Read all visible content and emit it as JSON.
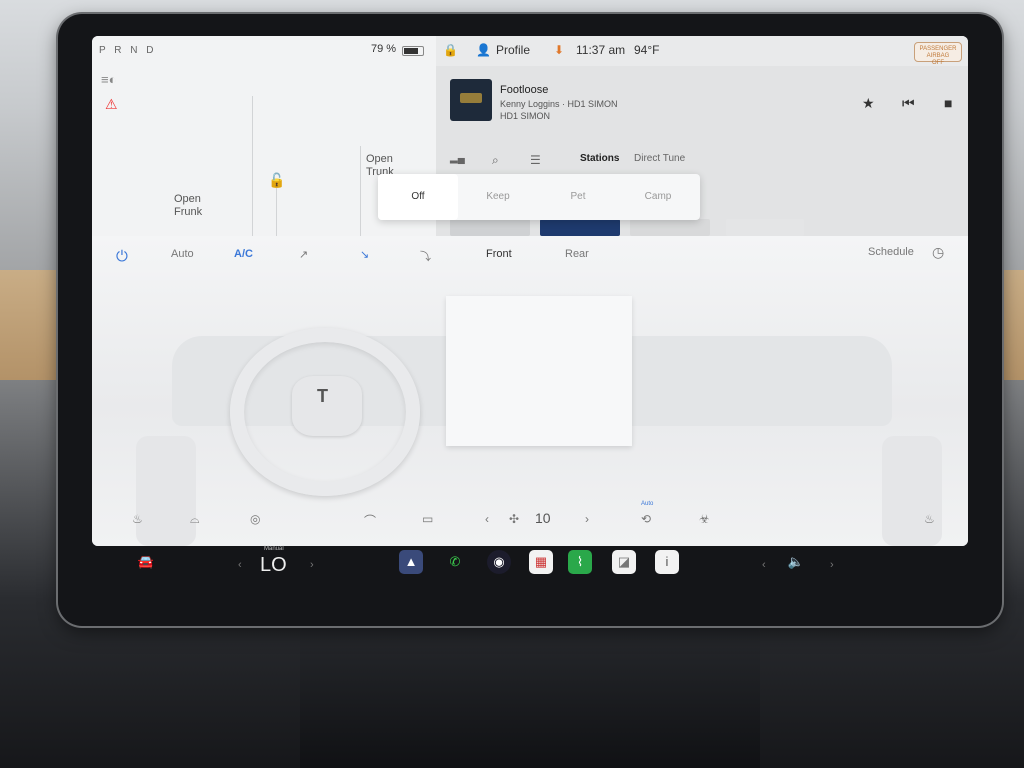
{
  "vehicle": {
    "gear": "P R N D",
    "battery_percent": "79 %",
    "battery_level": 0.79,
    "open_frunk_line1": "Open",
    "open_frunk_line2": "Frunk",
    "open_trunk_line1": "Open",
    "open_trunk_line2": "Trunk"
  },
  "status_bar": {
    "profile_label": "Profile",
    "time": "11:37 am",
    "temperature": "94°F",
    "airbag_line1": "PASSENGER",
    "airbag_line2": "AIRBAG",
    "airbag_line3": "OFF"
  },
  "media": {
    "song_title": "Footloose",
    "artist": "Kenny Loggins · HD1 SIMON",
    "station": "HD1 SIMON",
    "tabs": [
      "Stations",
      "Direct Tune"
    ],
    "controls": {
      "favorite": "★",
      "previous": "⏮",
      "stop": "■",
      "next": "⏭",
      "audio": "🔉"
    }
  },
  "climate_keeper": {
    "options": [
      "Off",
      "Keep",
      "Pet",
      "Camp"
    ],
    "selected": "Off"
  },
  "climate": {
    "auto_label": "Auto",
    "ac_label": "A/C",
    "front_label": "Front",
    "rear_label": "Rear",
    "schedule_label": "Schedule",
    "fan_speed": "10",
    "recirc_label": "Auto",
    "accent_color": "#3b78d8"
  },
  "dock": {
    "manual_label": "Manual",
    "driver_temp": "LO"
  }
}
